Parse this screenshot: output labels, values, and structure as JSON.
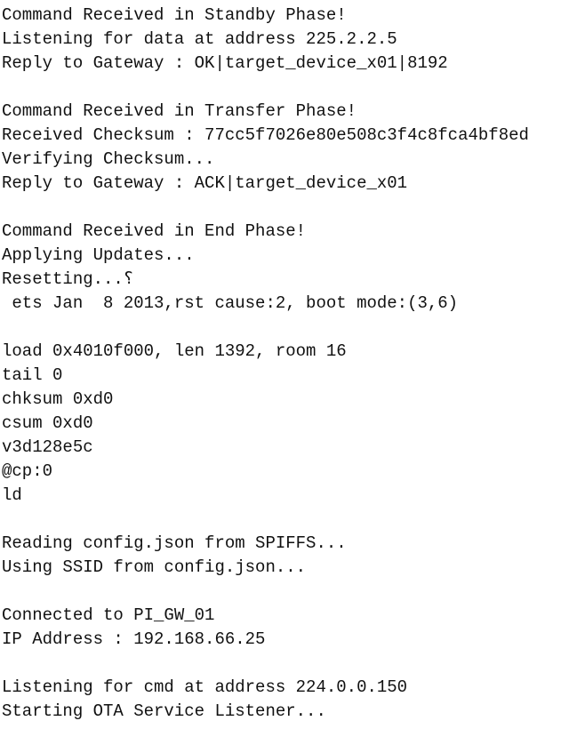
{
  "console": {
    "lines": [
      "Command Received in Standby Phase!",
      "Listening for data at address 225.2.2.5",
      "Reply to Gateway : OK|target_device_x01|8192",
      "",
      "Command Received in Transfer Phase!",
      "Received Checksum : 77cc5f7026e80e508c3f4c8fca4bf8ed",
      "Verifying Checksum...",
      "Reply to Gateway : ACK|target_device_x01",
      "",
      "Command Received in End Phase!",
      "Applying Updates...",
      "Resetting...؟",
      " ets Jan  8 2013,rst cause:2, boot mode:(3,6)",
      "",
      "load 0x4010f000, len 1392, room 16",
      "tail 0",
      "chksum 0xd0",
      "csum 0xd0",
      "v3d128e5c",
      "@cp:0",
      "ld",
      "",
      "Reading config.json from SPIFFS...",
      "Using SSID from config.json...",
      "",
      "Connected to PI_GW_01",
      "IP Address : 192.168.66.25",
      "",
      "Listening for cmd at address 224.0.0.150",
      "Starting OTA Service Listener..."
    ]
  }
}
